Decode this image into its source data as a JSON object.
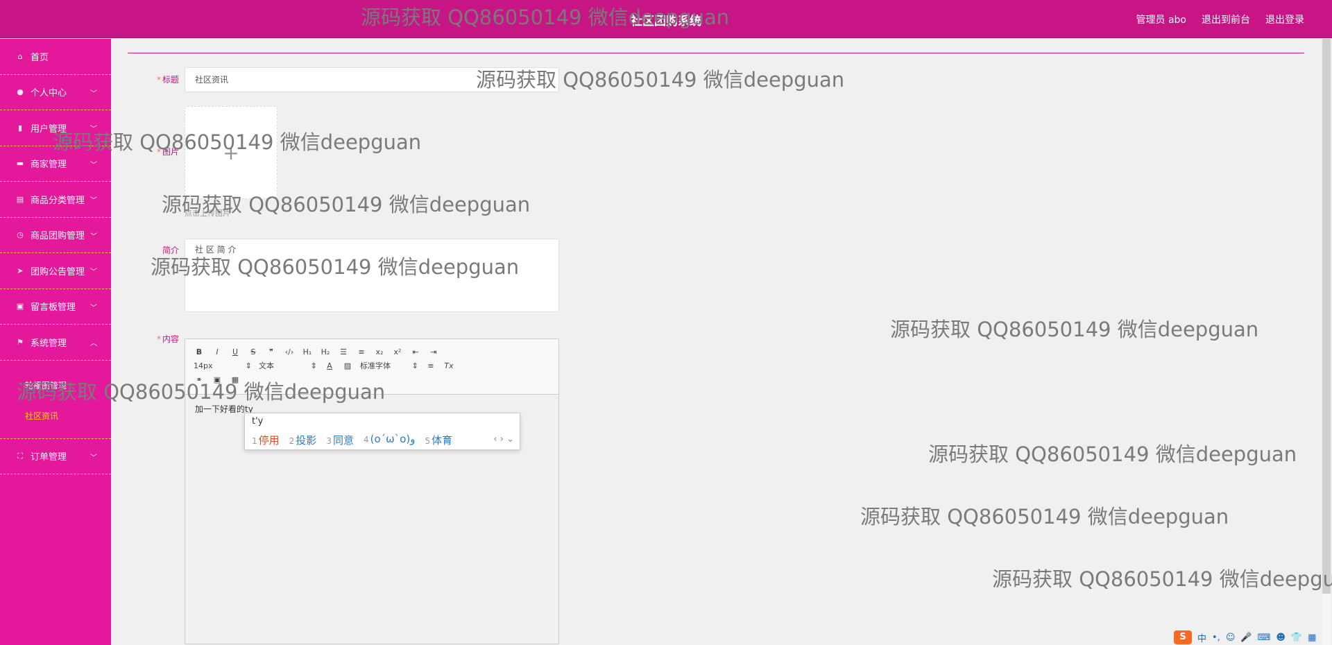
{
  "header": {
    "title": "社区团购系统",
    "user_label": "管理员 abo",
    "back_front": "退出到前台",
    "logout": "退出登录"
  },
  "sidebar": {
    "items": [
      {
        "label": "首页",
        "icon": "home-icon"
      },
      {
        "label": "个人中心",
        "icon": "user-icon"
      },
      {
        "label": "用户管理",
        "icon": "chart-icon"
      },
      {
        "label": "商家管理",
        "icon": "briefcase-icon"
      },
      {
        "label": "商品分类管理",
        "icon": "clipboard-icon"
      },
      {
        "label": "商品团购管理",
        "icon": "clock-icon"
      },
      {
        "label": "团购公告管理",
        "icon": "send-icon"
      },
      {
        "label": "留言板管理",
        "icon": "message-icon"
      },
      {
        "label": "系统管理",
        "icon": "flag-icon"
      },
      {
        "label": "订单管理",
        "icon": "expand-icon"
      }
    ],
    "sub_items": [
      {
        "label": "轮播图管理"
      },
      {
        "label": "社区资讯"
      }
    ]
  },
  "form": {
    "title_label": "标题",
    "title_value": "社区资讯",
    "image_label": "图片",
    "upload_tip": "点击上传图片",
    "intro_label": "简介",
    "intro_value": "社 区 简 介",
    "content_label": "内容",
    "content_value": "加一下好看的ty"
  },
  "editor_toolbar": {
    "font_size": "14px",
    "text_type": "文本",
    "font_family": "标准字体"
  },
  "ime": {
    "code": "t'y",
    "candidates": [
      {
        "num": "1",
        "text": "停用"
      },
      {
        "num": "2",
        "text": "投影"
      },
      {
        "num": "3",
        "text": "同意"
      },
      {
        "num": "4",
        "text": "(o´ω`o)و"
      },
      {
        "num": "5",
        "text": "体育"
      }
    ]
  },
  "watermark": "源码获取 QQ86050149 微信deepguan",
  "imebar": {
    "logo": "S",
    "mode": "中"
  }
}
